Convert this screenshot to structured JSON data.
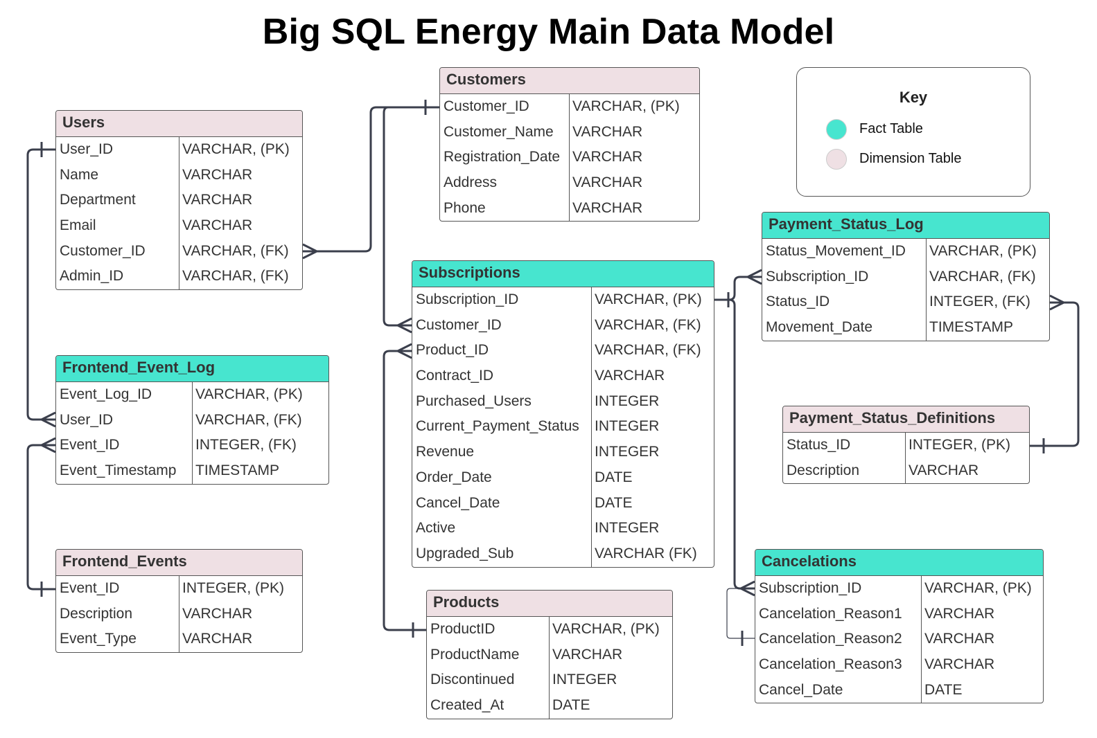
{
  "title": "Big SQL Energy Main Data Model",
  "colors": {
    "fact": "#47e5cf",
    "dimension": "#efe0e4",
    "line": "#3b3f4c"
  },
  "key": {
    "title": "Key",
    "items": [
      {
        "label": "Fact Table",
        "kind": "fact"
      },
      {
        "label": "Dimension Table",
        "kind": "dimension"
      }
    ]
  },
  "tables": {
    "users": {
      "name": "Users",
      "kind": "dimension",
      "rows": [
        [
          "User_ID",
          "VARCHAR, (PK)"
        ],
        [
          "Name",
          "VARCHAR"
        ],
        [
          "Department",
          "VARCHAR"
        ],
        [
          "Email",
          "VARCHAR"
        ],
        [
          "Customer_ID",
          "VARCHAR, (FK)"
        ],
        [
          "Admin_ID",
          "VARCHAR, (FK)"
        ]
      ]
    },
    "customers": {
      "name": "Customers",
      "kind": "dimension",
      "rows": [
        [
          "Customer_ID",
          "VARCHAR, (PK)"
        ],
        [
          "Customer_Name",
          "VARCHAR"
        ],
        [
          "Registration_Date",
          "VARCHAR"
        ],
        [
          "Address",
          "VARCHAR"
        ],
        [
          "Phone",
          "VARCHAR"
        ]
      ]
    },
    "frontend_event_log": {
      "name": "Frontend_Event_Log",
      "kind": "fact",
      "rows": [
        [
          "Event_Log_ID",
          "VARCHAR, (PK)"
        ],
        [
          "User_ID",
          "VARCHAR, (FK)"
        ],
        [
          "Event_ID",
          "INTEGER, (FK)"
        ],
        [
          "Event_Timestamp",
          "TIMESTAMP"
        ]
      ]
    },
    "frontend_events": {
      "name": "Frontend_Events",
      "kind": "dimension",
      "rows": [
        [
          "Event_ID",
          "INTEGER, (PK)"
        ],
        [
          "Description",
          "VARCHAR"
        ],
        [
          "Event_Type",
          "VARCHAR"
        ]
      ]
    },
    "subscriptions": {
      "name": "Subscriptions",
      "kind": "fact",
      "rows": [
        [
          "Subscription_ID",
          "VARCHAR, (PK)"
        ],
        [
          "Customer_ID",
          "VARCHAR, (FK)"
        ],
        [
          "Product_ID",
          "VARCHAR, (FK)"
        ],
        [
          "Contract_ID",
          "VARCHAR"
        ],
        [
          "Purchased_Users",
          "INTEGER"
        ],
        [
          "Current_Payment_Status",
          "INTEGER"
        ],
        [
          "Revenue",
          "INTEGER"
        ],
        [
          "Order_Date",
          "DATE"
        ],
        [
          "Cancel_Date",
          "DATE"
        ],
        [
          "Active",
          "INTEGER"
        ],
        [
          "Upgraded_Sub",
          "VARCHAR (FK)"
        ]
      ]
    },
    "products": {
      "name": "Products",
      "kind": "dimension",
      "rows": [
        [
          "ProductID",
          "VARCHAR, (PK)"
        ],
        [
          "ProductName",
          "VARCHAR"
        ],
        [
          "Discontinued",
          "INTEGER"
        ],
        [
          "Created_At",
          "DATE"
        ]
      ]
    },
    "payment_status_log": {
      "name": "Payment_Status_Log",
      "kind": "fact",
      "rows": [
        [
          "Status_Movement_ID",
          "VARCHAR, (PK)"
        ],
        [
          "Subscription_ID",
          "VARCHAR, (FK)"
        ],
        [
          "Status_ID",
          "INTEGER, (FK)"
        ],
        [
          "Movement_Date",
          "TIMESTAMP"
        ]
      ]
    },
    "payment_status_definitions": {
      "name": "Payment_Status_Definitions",
      "kind": "dimension",
      "rows": [
        [
          "Status_ID",
          "INTEGER, (PK)"
        ],
        [
          "Description",
          "VARCHAR"
        ]
      ]
    },
    "cancelations": {
      "name": "Cancelations",
      "kind": "fact",
      "rows": [
        [
          "Subscription_ID",
          "VARCHAR, (PK)"
        ],
        [
          "Cancelation_Reason1",
          "VARCHAR"
        ],
        [
          "Cancelation_Reason2",
          "VARCHAR"
        ],
        [
          "Cancelation_Reason3",
          "VARCHAR"
        ],
        [
          "Cancel_Date",
          "DATE"
        ]
      ]
    }
  }
}
